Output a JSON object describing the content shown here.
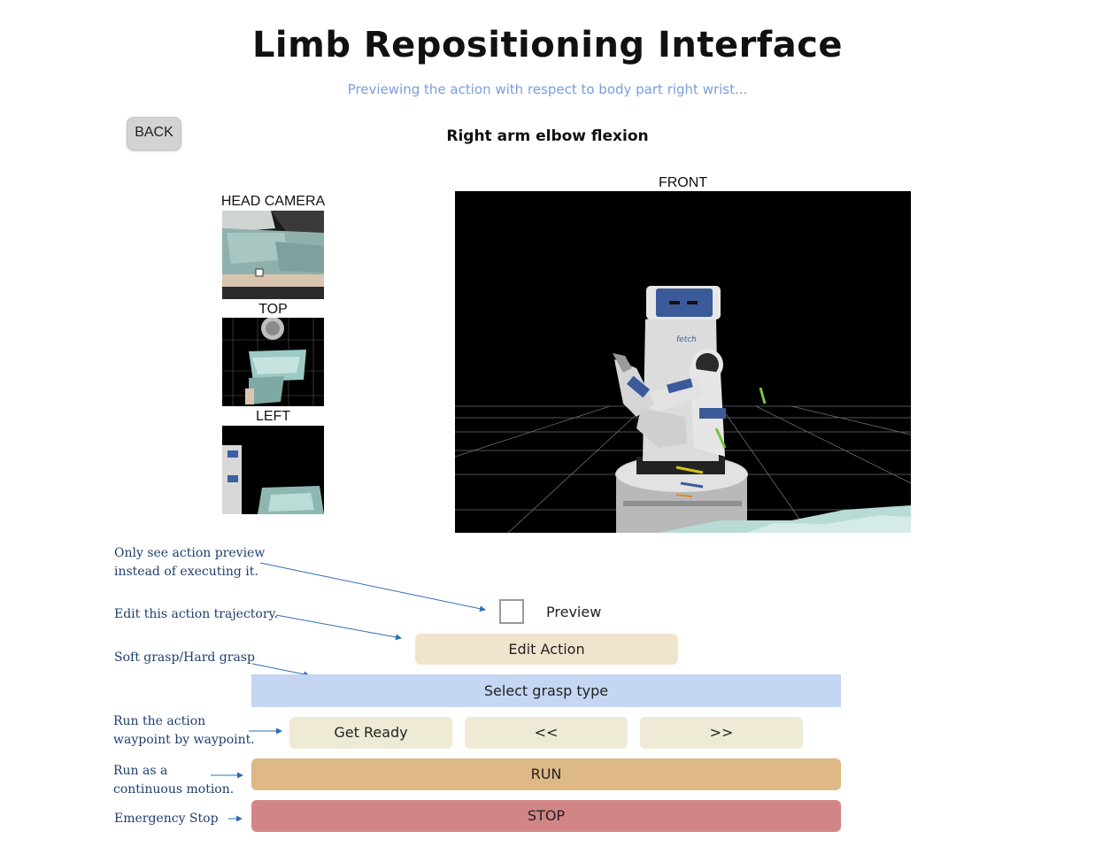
{
  "header": {
    "title": "Limb Repositioning Interface",
    "subtitle": "Previewing the action with respect to body part right wrist...",
    "action_name": "Right arm elbow flexion"
  },
  "nav": {
    "back_label": "BACK"
  },
  "cameras": {
    "head_label": "HEAD CAMERA",
    "top_label": "TOP",
    "left_label": "LEFT",
    "front_label": "FRONT"
  },
  "robot_view": {
    "logo_text": "fetch"
  },
  "annotations": {
    "preview_note": [
      "Only see action preview",
      "instead of executing it."
    ],
    "edit_note": "Edit this action trajectory.",
    "grasp_note": "Soft grasp/Hard grasp",
    "step_note": [
      "Run the action",
      "waypoint by waypoint."
    ],
    "run_note": [
      "Run as a",
      "continuous motion."
    ],
    "stop_note": "Emergency Stop"
  },
  "controls": {
    "preview_label": "Preview",
    "preview_checked": false,
    "edit_action_label": "Edit Action",
    "grasp_label": "Select grasp type",
    "get_ready_label": "Get Ready",
    "prev_label": "<<",
    "next_label": ">>",
    "run_label": "RUN",
    "stop_label": "STOP"
  },
  "colors": {
    "subtitle": "#7a9edb",
    "annotation": "#1f3d6e",
    "arrow": "#2f6db3",
    "edit_action": "#f1e4cd",
    "grasp": "#c4d6f2",
    "step_buttons": "#eeead5",
    "run": "#deb887",
    "stop": "#d28587"
  }
}
